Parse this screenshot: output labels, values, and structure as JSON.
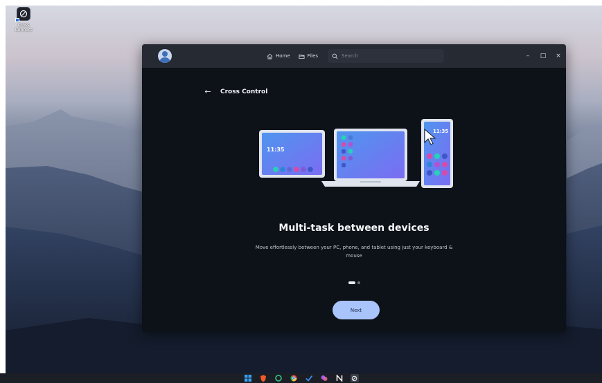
{
  "desktop": {
    "icon_label": "Cross Connect"
  },
  "window": {
    "nav": {
      "home_label": "Home",
      "files_label": "Files"
    },
    "search": {
      "placeholder": "Search"
    },
    "controls": {
      "minimize": "–",
      "maximize": "□",
      "close": "×"
    }
  },
  "page": {
    "back_title": "Cross Control",
    "illustration": {
      "tablet_time": "11:35",
      "phone_time": "11:35"
    },
    "headline": "Multi-task between devices",
    "subtext": "Move effortlessly between your PC, phone, and tablet using just your keyboard & mouse",
    "pagination": {
      "total": 2,
      "current": 1
    },
    "next_label": "Next"
  },
  "colors": {
    "window_bg": "#0d1118",
    "titlebar_bg": "#262a33",
    "accent_button": "#a9c3fb",
    "screen_blue": "#5b8ef0",
    "screen_purple": "#7d6ff2"
  },
  "taskbar": {
    "icons": [
      "windows-start-icon",
      "brave-browser-icon",
      "circle-app-icon",
      "chrome-icon",
      "checkmark-app-icon",
      "colorful-app-icon",
      "notion-icon",
      "cross-connect-icon"
    ]
  }
}
